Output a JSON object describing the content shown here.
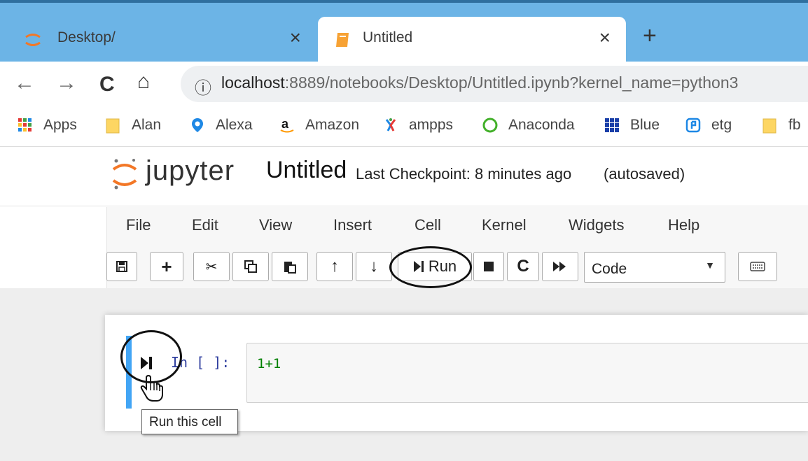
{
  "browser": {
    "tabs": [
      {
        "title": "Desktop/",
        "close": "×",
        "icon": "jupyter-favicon"
      },
      {
        "title": "Untitled",
        "close": "×",
        "icon": "notebook-favicon"
      }
    ],
    "new_tab": "+",
    "nav": {
      "back": "←",
      "forward": "→",
      "reload": "C",
      "home": "⌂"
    },
    "omnibox": {
      "info": "ⓘ",
      "host": "localhost",
      "rest": ":8889/notebooks/Desktop/Untitled.ipynb?kernel_name=python3"
    },
    "bookmarks": [
      {
        "label": "Apps",
        "icon": "apps-grid-icon"
      },
      {
        "label": "Alan",
        "icon": "folder-icon"
      },
      {
        "label": "Alexa",
        "icon": "location-pin-icon"
      },
      {
        "label": "Amazon",
        "icon": "amazon-icon"
      },
      {
        "label": "ampps",
        "icon": "ampps-icon"
      },
      {
        "label": "Anaconda",
        "icon": "anaconda-icon"
      },
      {
        "label": "Blue",
        "icon": "blue-grid-icon"
      },
      {
        "label": "etg",
        "icon": "etg-icon"
      },
      {
        "label": "fb",
        "icon": "folder-icon"
      }
    ]
  },
  "jupyter": {
    "brand": "jupyter",
    "notebook_title": "Untitled",
    "checkpoint": "Last Checkpoint: 8 minutes ago",
    "autosave": "(autosaved)",
    "menu": [
      "File",
      "Edit",
      "View",
      "Insert",
      "Cell",
      "Kernel",
      "Widgets",
      "Help"
    ],
    "toolbar": {
      "run_label": "Run",
      "cell_type": "Code"
    },
    "cell": {
      "prompt": "In [ ]:",
      "code": "1+1"
    },
    "tooltip": "Run this cell"
  },
  "colors": {
    "tabstrip": "#6cb4e6",
    "cell_selected": "#42a5f5",
    "prompt": "#303f9f",
    "code": "#008000",
    "jupyter_orange": "#f37726"
  }
}
